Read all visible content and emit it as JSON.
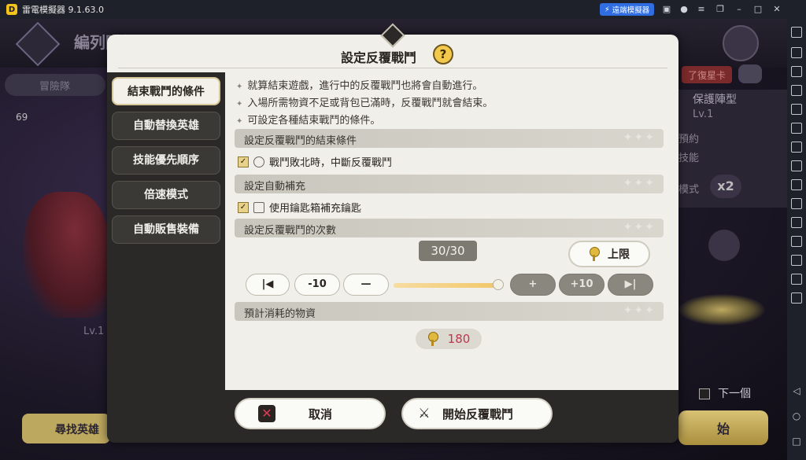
{
  "window": {
    "title": "雷電模擬器 9.1.63.0",
    "remote_label": "遠端模擬器"
  },
  "background": {
    "page_title": "編列隊伍",
    "tab_label": "冒險隊",
    "count": "69",
    "red_badge": "了復星卡",
    "protect_type": "保護陣型",
    "protect_lv": "Lv.1",
    "reserve_label": "預約",
    "skill_label": "技能",
    "mode_label": "模式",
    "speed": "x2",
    "left_lv": "Lv.1",
    "search_hero": "尋找英雄",
    "next_one": "下一個",
    "start_label": "始"
  },
  "dialog": {
    "title": "設定反覆戰鬥",
    "help": "?",
    "side_tabs": [
      {
        "label": "結束戰鬥的條件",
        "active": true
      },
      {
        "label": "自動替換英雄",
        "active": false
      },
      {
        "label": "技能優先順序",
        "active": false
      },
      {
        "label": "倍速模式",
        "active": false
      },
      {
        "label": "自動販售裝備",
        "active": false
      }
    ],
    "notes": [
      "就算結束遊戲，進行中的反覆戰鬥也將會自動進行。",
      "入場所需物資不足或背包已滿時，反覆戰鬥就會結束。",
      "可設定各種結束戰鬥的條件。"
    ],
    "sections": {
      "end_conditions": "設定反覆戰鬥的結束條件",
      "auto_refill": "設定自動補充",
      "repeat_count": "設定反覆戰鬥的次數",
      "expected_cost": "預計消耗的物資"
    },
    "options": {
      "stop_on_defeat": {
        "label": "戰鬥敗北時，中斷反覆戰鬥",
        "checked": true
      },
      "use_key_box": {
        "label": "使用鑰匙箱補充鑰匙",
        "checked": true
      }
    },
    "repeat": {
      "current": 30,
      "max": 30,
      "display": "30/30",
      "limit_label": "上限",
      "minus10": "-10",
      "plus10": "+10"
    },
    "cost": {
      "value": "180"
    },
    "buttons": {
      "cancel": "取消",
      "start": "開始反覆戰鬥"
    }
  },
  "colors": {
    "accent_gold": "#e0b93e",
    "cost_red": "#c0364c",
    "panel_bg": "#f0efea",
    "dark_frame": "#2a2927"
  }
}
